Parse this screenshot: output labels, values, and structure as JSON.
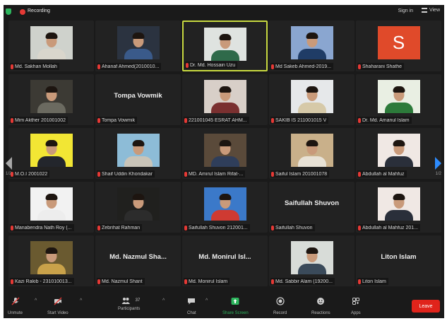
{
  "topbar": {
    "recording": "Recording",
    "signin": "Sign in",
    "view": "View"
  },
  "nav": {
    "page_left": "1/2",
    "page_right": "1/2"
  },
  "participants": [
    {
      "name": "Md. Sakhan Mollah",
      "type": "photo",
      "bg": "#cfd2cc",
      "shirt": "#d9d6cc"
    },
    {
      "name": "Ahanaf Ahmed(2010010...",
      "type": "photo",
      "bg": "#2b3340",
      "shirt": "#3a5a8a"
    },
    {
      "name": "Dr. Md. Hossain Uzu",
      "type": "photo",
      "bg": "#dfe3e0",
      "shirt": "#2f6a4a",
      "active": true
    },
    {
      "name": "Md Sakeb Ahmed-2019...",
      "type": "photo",
      "bg": "#8aa6d0",
      "shirt": "#1f3c66"
    },
    {
      "name": "Shaharani Shathe",
      "type": "letter",
      "letter": "S",
      "bg": "#e04a2a"
    },
    {
      "name": "Mim Akther 201001002",
      "type": "photo",
      "bg": "#3c3a34",
      "shirt": "#6b6a60"
    },
    {
      "name": "Tompa Vowmik",
      "type": "text",
      "display": "Tompa Vowmik"
    },
    {
      "name": "221001045 ESRAT AHM...",
      "type": "photo",
      "bg": "#d8cfc8",
      "shirt": "#7a3030"
    },
    {
      "name": "SAKIB IS 211001015 V",
      "type": "photo",
      "bg": "#e6e8ea",
      "shirt": "#d6c9a8"
    },
    {
      "name": "Dr. Md. Amanul Islam",
      "type": "photo",
      "bg": "#e9efe3",
      "shirt": "#2c7a3a"
    },
    {
      "name": "M.O.I 2001022",
      "type": "photo",
      "bg": "#f2e634",
      "shirt": "#23262c"
    },
    {
      "name": "Shaif Uddin Khondakar",
      "type": "photo",
      "bg": "#8dbcd7",
      "shirt": "#c9c4b8"
    },
    {
      "name": "MD. Amirul Islam Rifat-...",
      "type": "photo",
      "bg": "#5a4a3a",
      "shirt": "#2f3e5a"
    },
    {
      "name": "Saiful Islam 201001078",
      "type": "photo",
      "bg": "#c9b08a",
      "shirt": "#e8e2d6"
    },
    {
      "name": "Abdullah al Mahfuz",
      "type": "photo",
      "bg": "#f0e8e4",
      "shirt": "#2a2f3a"
    },
    {
      "name": "Manabendra Nath Roy (...",
      "type": "photo",
      "bg": "#f2f2f2",
      "shirt": "#ededed"
    },
    {
      "name": "Zebrihat Rahman",
      "type": "photo",
      "bg": "#20201e",
      "shirt": "#2c2c2c"
    },
    {
      "name": "Saifullah Shuvon 212001...",
      "type": "photo",
      "bg": "#3b79c9",
      "shirt": "#cf3a32"
    },
    {
      "name": "Saifullah Shuvon",
      "type": "text",
      "display": "Saifullah Shuvon"
    },
    {
      "name": "Abdullah al Mahfuz 201...",
      "type": "photo",
      "bg": "#f0e8e4",
      "shirt": "#2a2f3a"
    },
    {
      "name": "Kazi Rakib - 231010013...",
      "type": "photo",
      "bg": "#6a5a30",
      "shirt": "#c9a24a"
    },
    {
      "name": "Md. Nazmul Shant",
      "type": "text",
      "display": "Md. Nazmul Sha..."
    },
    {
      "name": "Md. Monirul Islam",
      "type": "text",
      "display": "Md. Monirul Isl..."
    },
    {
      "name": "Md. Sabbir Alam (19200...",
      "type": "photo",
      "bg": "#d8dcd8",
      "shirt": "#3a4a5a"
    },
    {
      "name": "Liton Islam",
      "type": "text",
      "display": "Liton Islam"
    }
  ],
  "toolbar": {
    "unmute": "Unmute",
    "start_video": "Start Video",
    "participants": "Participants",
    "participants_count": "37",
    "chat": "Chat",
    "share_screen": "Share Screen",
    "record": "Record",
    "reactions": "Reactions",
    "apps": "Apps",
    "leave": "Leave"
  },
  "colors": {
    "active_border": "#c8d940",
    "share_green": "#2db55d",
    "leave_red": "#e0241b",
    "nav_blue": "#2d8cff"
  }
}
